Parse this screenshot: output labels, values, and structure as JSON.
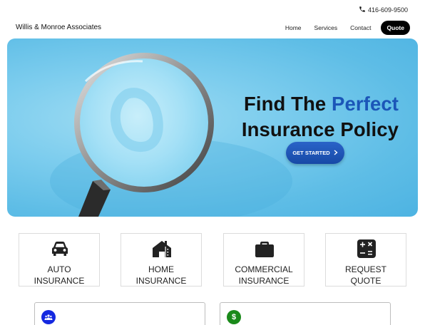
{
  "topbar": {
    "phone_icon": "phone-icon",
    "phone": "416-609-9500"
  },
  "nav": {
    "brand": "Willis & Monroe Associates",
    "links": [
      "Home",
      "Services",
      "Contact"
    ],
    "cta": "Quote"
  },
  "hero": {
    "title_part1": "Find The ",
    "title_accent": "Perfect",
    "title_line2": "Insurance Policy",
    "button": "GET STARTED",
    "button_icon": "chevron-right-icon",
    "image": "magnifying-glass-image",
    "accent_color": "#1b56b8",
    "background_color": "#5ebde6"
  },
  "services": [
    {
      "icon": "car-icon",
      "line1": "AUTO",
      "line2": "INSURANCE"
    },
    {
      "icon": "house-icon",
      "line1": "HOME",
      "line2": "INSURANCE"
    },
    {
      "icon": "briefcase-icon",
      "line1": "COMMERCIAL",
      "line2": "INSURANCE"
    },
    {
      "icon": "calculator-icon",
      "line1": "REQUEST",
      "line2": "QUOTE"
    }
  ],
  "panels": [
    {
      "icon": "people-icon",
      "color": "#1428e0"
    },
    {
      "icon": "dollar-icon",
      "symbol": "$",
      "color": "#1a8a1a"
    }
  ]
}
